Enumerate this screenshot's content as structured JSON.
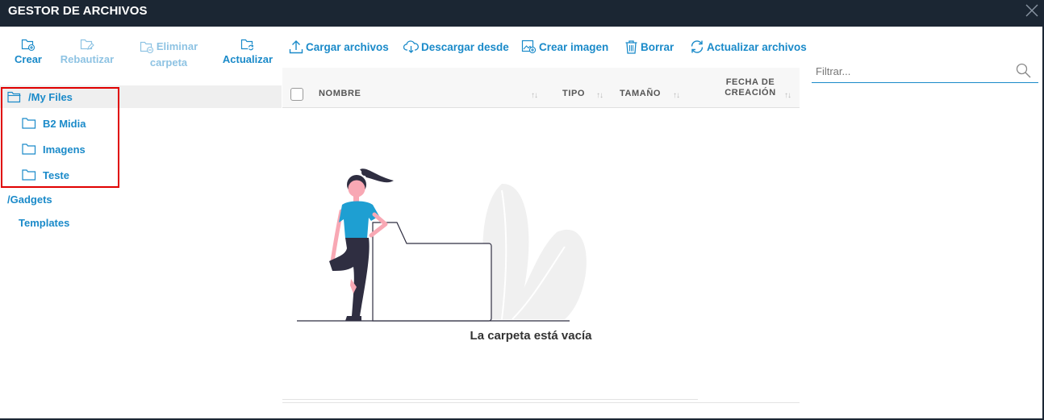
{
  "window": {
    "title": "GESTOR DE ARCHIVOS",
    "close_icon": "close-icon"
  },
  "folder_toolbar": {
    "create_label": "Crear",
    "rename_label": "Rebautizar",
    "delete_folder_line1": "Eliminar",
    "delete_folder_line2": "carpeta",
    "refresh_label": "Actualizar"
  },
  "file_toolbar": {
    "upload_label": "Cargar archivos",
    "download_label": "Descargar desde",
    "create_image_label": "Crear imagen",
    "delete_label": "Borrar",
    "refresh_files_label": "Actualizar archivos"
  },
  "filter": {
    "placeholder": "Filtrar..."
  },
  "tree": {
    "root": "/My Files",
    "children": [
      "B2 Midia",
      "Imagens",
      "Teste"
    ],
    "gadgets": "/Gadgets",
    "templates": "Templates"
  },
  "grid": {
    "columns": {
      "name": "NOMBRE",
      "type": "TIPO",
      "size": "TAMAÑO",
      "date_line1": "FECHA DE",
      "date_line2": "CREACIÓN"
    },
    "sort_glyph": "↑↓",
    "empty_message": "La carpeta está vacía"
  },
  "colors": {
    "accent": "#1a8ac9",
    "accent_disabled": "#8ec3e3",
    "titlebar": "#1b2633",
    "highlight": "#e00000",
    "figure_shirt": "#1e9fd2",
    "figure_pants": "#2f2e41",
    "figure_skin": "#f8a8b4"
  }
}
